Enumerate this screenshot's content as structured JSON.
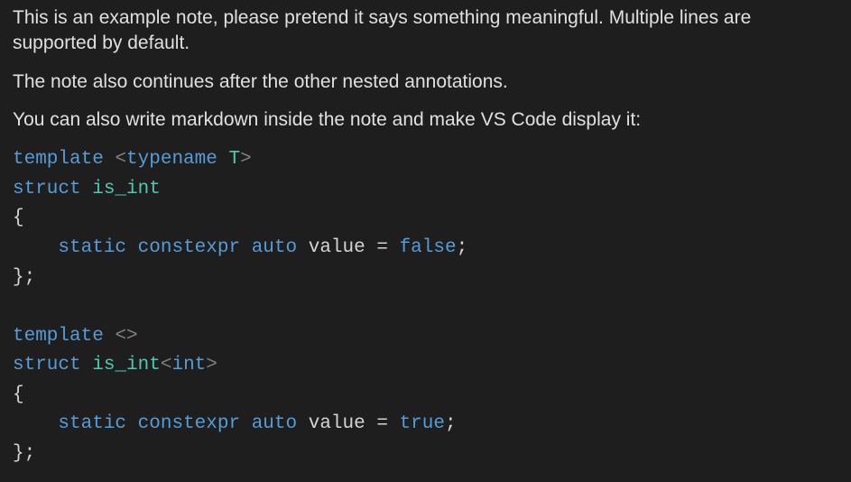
{
  "paragraphs": [
    "This is an example note, please pretend it says something meaningful. Multiple lines are supported by default.",
    "The note also continues after the other nested annotations.",
    "You can also write markdown inside the note and make VS Code display it:"
  ],
  "code": {
    "kw_template": "template",
    "kw_typename": "typename",
    "type_T": "T",
    "kw_struct": "struct",
    "type_is_int": "is_int",
    "brace_open": "{",
    "brace_close_semicolon": "};",
    "kw_static": "static",
    "kw_constexpr": "constexpr",
    "kw_auto": "auto",
    "ident_value": "value",
    "op_eq": "=",
    "kw_false": "false",
    "kw_true": "true",
    "kw_int": "int",
    "semicolon": ";",
    "lt": "<",
    "gt": ">",
    "empty_angles": "<>",
    "indent": "    "
  }
}
